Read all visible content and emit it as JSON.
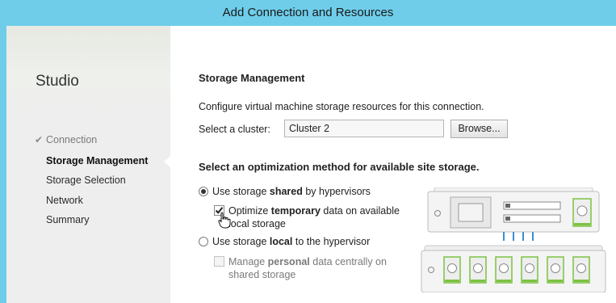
{
  "window": {
    "title": "Add Connection and Resources"
  },
  "sidebar": {
    "brand": "Studio",
    "completed_mark": "✔",
    "items": [
      {
        "label": "Connection"
      },
      {
        "label": "Storage Management"
      },
      {
        "label": "Storage Selection"
      },
      {
        "label": "Network"
      },
      {
        "label": "Summary"
      }
    ]
  },
  "main": {
    "title": "Storage Management",
    "description": "Configure virtual machine storage resources for this connection.",
    "cluster_label": "Select a cluster:",
    "cluster_value": "Cluster 2",
    "browse_label": "Browse...",
    "optimization_heading": "Select an optimization method for available site storage.",
    "option_shared": {
      "prefix": "Use storage ",
      "bold": "shared",
      "suffix": " by hypervisors",
      "selected": true
    },
    "option_temp": {
      "prefix": "Optimize ",
      "bold": "temporary",
      "suffix": " data on available",
      "line2": "local storage",
      "checked": true
    },
    "option_local": {
      "prefix": "Use storage ",
      "bold": "local",
      "suffix": " to the hypervisor",
      "selected": false
    },
    "option_personal": {
      "prefix": "Manage ",
      "bold": "personal",
      "suffix": " data centrally on",
      "line2": "shared storage",
      "checked": false,
      "disabled": true
    }
  },
  "colors": {
    "titlebar": "#6fcdea",
    "accent_green": "#7cc242",
    "connector_blue": "#3b8fd4"
  }
}
